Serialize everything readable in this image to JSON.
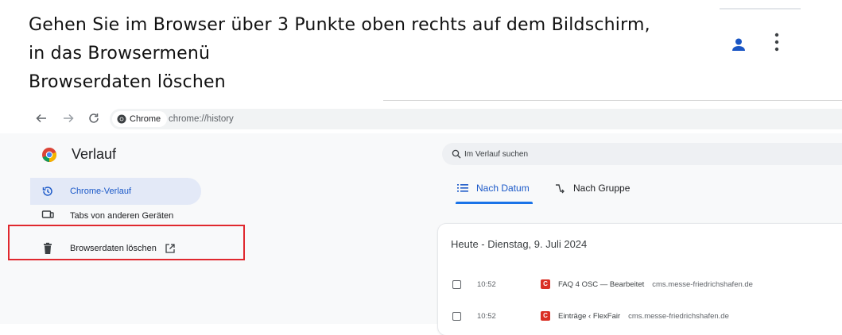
{
  "instructions": {
    "line1": "Gehen Sie im Browser über 3 Punkte oben rechts auf dem Bildschirm,",
    "line2": "in das Browsermenü",
    "line3": "Browserdaten löschen"
  },
  "account": {
    "avatar_icon": "person-icon",
    "menu_icon": "three-dots-vertical-icon"
  },
  "browser": {
    "chip_label": "Chrome",
    "url": "chrome://history"
  },
  "sidebar": {
    "title": "Verlauf",
    "items": [
      {
        "label": "Chrome-Verlauf",
        "icon": "history-icon",
        "active": true
      },
      {
        "label": "Tabs von anderen Geräten",
        "icon": "devices-icon"
      },
      {
        "label": "Browserdaten löschen",
        "icon": "trash-icon",
        "external_icon": "open-in-new-icon"
      }
    ]
  },
  "search": {
    "placeholder": "Im Verlauf suchen"
  },
  "tabs": [
    {
      "label": "Nach Datum",
      "icon": "list-icon",
      "active": true
    },
    {
      "label": "Nach Gruppe",
      "icon": "group-icon"
    }
  ],
  "history": {
    "day_heading": "Heute - Dienstag, 9. Juli 2024",
    "entries": [
      {
        "time": "10:52",
        "title": "FAQ 4 OSC — Bearbeitet",
        "domain": "cms.messe-friedrichshafen.de",
        "favicon": "C"
      },
      {
        "time": "10:52",
        "title": "Einträge ‹ FlexFair",
        "domain": "cms.messe-friedrichshafen.de",
        "favicon": "C"
      }
    ]
  },
  "colors": {
    "accent": "#1a73e8",
    "highlight": "#e0282e",
    "active_bg": "#e3e9f7"
  }
}
